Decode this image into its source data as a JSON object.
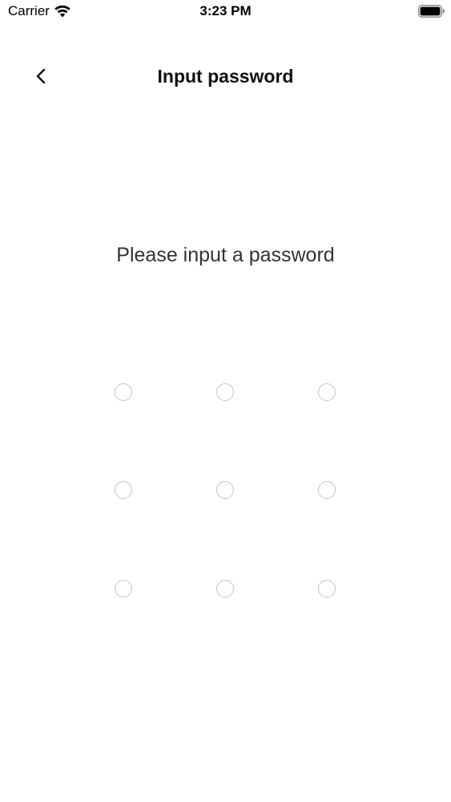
{
  "status_bar": {
    "carrier": "Carrier",
    "time": "3:23 PM",
    "wifi_icon": "wifi-icon",
    "battery_icon": "battery-full-icon"
  },
  "nav": {
    "back_icon": "chevron-left-icon",
    "title": "Input password"
  },
  "main": {
    "prompt": "Please input a password",
    "pattern_nodes": 9,
    "node_border_color": "#c4c4c4"
  }
}
